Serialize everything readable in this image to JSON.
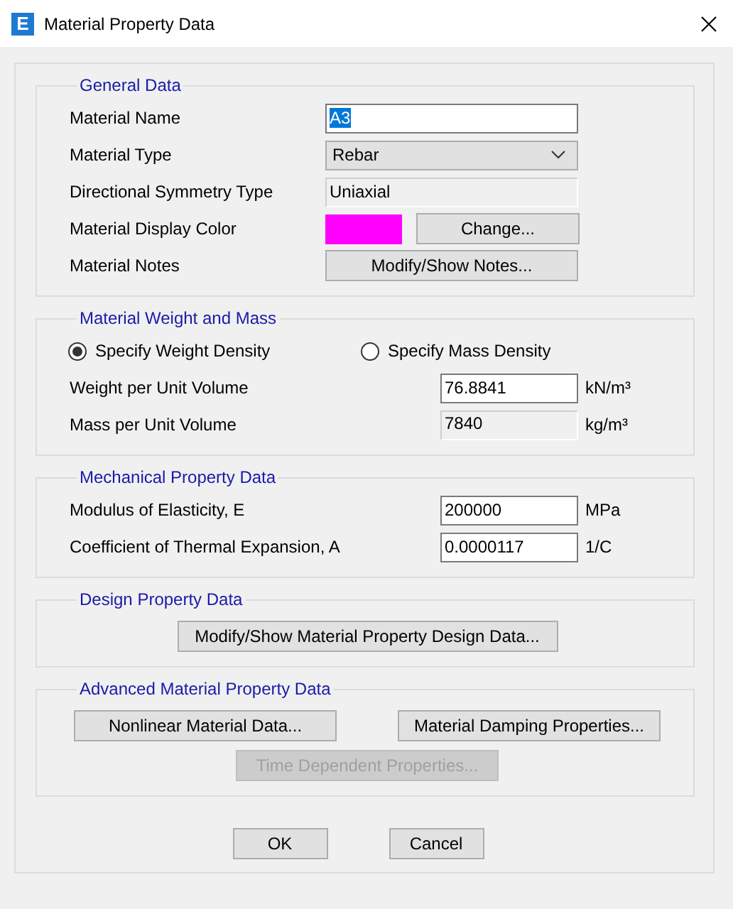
{
  "window": {
    "title": "Material Property Data",
    "icon_letter": "E"
  },
  "groups": [
    {
      "title": "General Data",
      "rows": [
        {
          "kind": "field",
          "label": "Material Name",
          "value": "A3",
          "disabled": false,
          "highlighted": true
        },
        {
          "kind": "dropdown",
          "label": "Material Type",
          "value": "Rebar"
        },
        {
          "kind": "field",
          "label": "Directional Symmetry Type",
          "value": "Uniaxial",
          "disabled": true,
          "highlighted": false
        },
        {
          "kind": "color",
          "label": "Material Display Color",
          "color": "#ff00ff",
          "button": "Change..."
        },
        {
          "kind": "button",
          "label": "Material Notes",
          "button": "Modify/Show Notes..."
        }
      ]
    },
    {
      "title": "Material Weight and Mass",
      "radios": [
        {
          "label": "Specify Weight Density",
          "selected": true
        },
        {
          "label": "Specify Mass Density",
          "selected": false
        }
      ],
      "rows": [
        {
          "kind": "number",
          "label": "Weight per Unit Volume",
          "value": "76.8841",
          "unit": "kN/m³",
          "disabled": false
        },
        {
          "kind": "number",
          "label": "Mass per Unit Volume",
          "value": "7840",
          "unit": "kg/m³",
          "disabled": true
        }
      ]
    },
    {
      "title": "Mechanical Property Data",
      "rows": [
        {
          "kind": "number",
          "label": "Modulus of Elasticity,  E",
          "value": "200000",
          "unit": "MPa",
          "disabled": false
        },
        {
          "kind": "number",
          "label": "Coefficient of Thermal Expansion,  A",
          "value": "0.0000117",
          "unit": "1/C",
          "disabled": false
        }
      ]
    },
    {
      "title": "Design Property Data",
      "buttons": [
        {
          "label": "Modify/Show Material Property Design Data...",
          "disabled": false
        }
      ]
    },
    {
      "title": "Advanced Material Property Data",
      "buttons": [
        {
          "label": "Nonlinear Material Data...",
          "disabled": false
        },
        {
          "label": "Material Damping Properties...",
          "disabled": false
        },
        {
          "label": "Time Dependent Properties...",
          "disabled": true
        }
      ]
    }
  ],
  "buttons": [
    "OK",
    "Cancel"
  ]
}
